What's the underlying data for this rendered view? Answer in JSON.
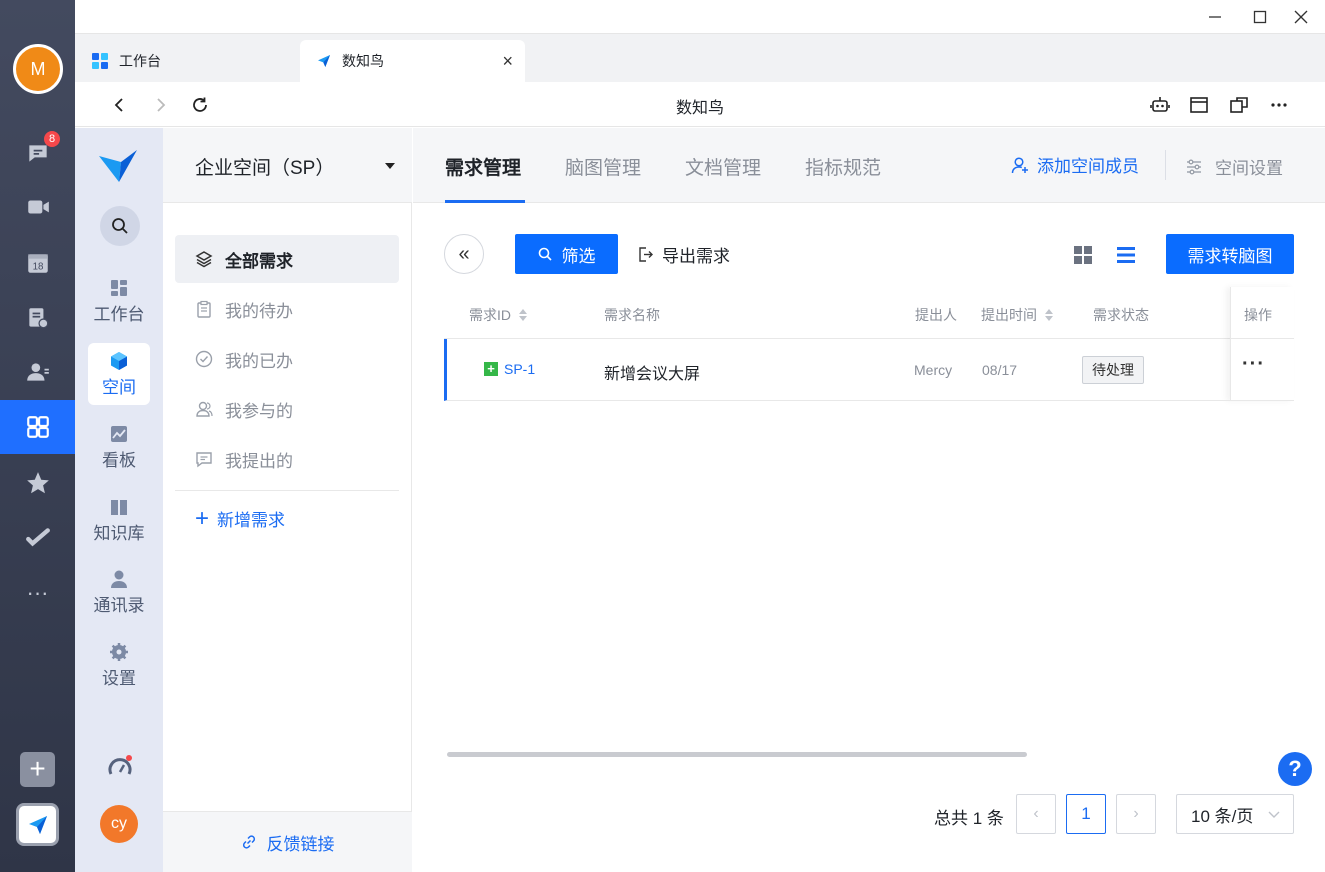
{
  "dock": {
    "avatar_initial": "M",
    "chat_badge": "8",
    "items": [
      "chat-icon",
      "video-icon",
      "calendar-icon",
      "approval-icon",
      "contacts-icon",
      "workspace-icon",
      "favorites-icon",
      "tasks-icon",
      "more-icon"
    ],
    "calendar_day": "18",
    "more": "···",
    "add": "+",
    "active_item": "workspace-icon"
  },
  "window": {
    "minimize": "—",
    "maximize": "☐",
    "close": "✕"
  },
  "tabs": [
    {
      "label": "工作台",
      "active": false
    },
    {
      "label": "数知鸟",
      "active": true
    }
  ],
  "navbar": {
    "title": "数知鸟"
  },
  "app_sidebar": {
    "items": [
      {
        "label": "工作台",
        "icon": "grid-icon"
      },
      {
        "label": "空间",
        "icon": "cube-icon",
        "active": true
      },
      {
        "label": "看板",
        "icon": "chart-icon"
      },
      {
        "label": "知识库",
        "icon": "book-icon"
      },
      {
        "label": "通讯录",
        "icon": "person-icon"
      },
      {
        "label": "设置",
        "icon": "gear-icon"
      }
    ],
    "user_avatar": "cy"
  },
  "space": {
    "name": "企业空间（SP）",
    "menu": [
      {
        "label": "全部需求",
        "icon": "layers-icon",
        "active": true
      },
      {
        "label": "我的待办",
        "icon": "clipboard-icon"
      },
      {
        "label": "我的已办",
        "icon": "check-circle-icon"
      },
      {
        "label": "我参与的",
        "icon": "users-icon"
      },
      {
        "label": "我提出的",
        "icon": "message-icon"
      }
    ],
    "add_label": "新增需求",
    "add_symbol": "+",
    "feedback_label": "反馈链接"
  },
  "topnav": {
    "tabs": [
      {
        "label": "需求管理",
        "active": true
      },
      {
        "label": "脑图管理"
      },
      {
        "label": "文档管理"
      },
      {
        "label": "指标规范"
      }
    ],
    "add_member": "添加空间成员",
    "settings": "空间设置"
  },
  "toolbar": {
    "collapse": "«",
    "filter": "筛选",
    "export": "导出需求",
    "convert": "需求转脑图"
  },
  "table": {
    "columns": [
      "需求ID",
      "需求名称",
      "提出人",
      "提出时间",
      "需求状态",
      "操作"
    ],
    "rows": [
      {
        "id": "SP-1",
        "name": "新增会议大屏",
        "proposer": "Mercy",
        "time": "08/17",
        "status": "待处理",
        "actions": "···"
      }
    ]
  },
  "pagination": {
    "total": "总共 1 条",
    "prev": "‹",
    "current": "1",
    "next": "›",
    "page_size": "10 条/页"
  },
  "help": "?",
  "colors": {
    "accent": "#1b6cf2",
    "primary_button": "#0a6cff",
    "dock_bg": "#3d4457",
    "avatar_orange": "#f08a17"
  }
}
